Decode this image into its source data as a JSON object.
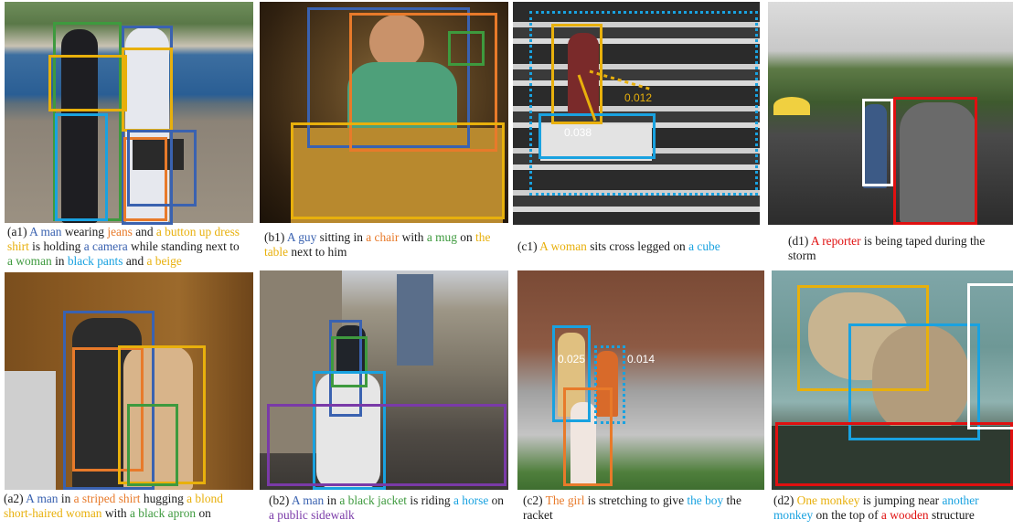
{
  "colors": {
    "blue": "#3a62b0",
    "orange": "#e87a2a",
    "yellow": "#e8b00c",
    "green": "#3e9a3e",
    "cyan": "#19a2e0",
    "red": "#e01010",
    "white": "#ffffff",
    "olive": "#8a9a2a",
    "purple": "#7a3aa8",
    "text": "#1a1a1a"
  },
  "panels": {
    "a1": {
      "label": "(a1)",
      "caption": [
        {
          "text": " A man",
          "color": "blue"
        },
        {
          "text": " wearing ",
          "color": "text"
        },
        {
          "text": "jeans",
          "color": "orange"
        },
        {
          "text": " and ",
          "color": "text"
        },
        {
          "text": "a button up dress shirt",
          "color": "yellow"
        },
        {
          "text": " is holding ",
          "color": "text"
        },
        {
          "text": "a camera",
          "color": "blue"
        },
        {
          "text": " while standing next to ",
          "color": "text"
        },
        {
          "text": "a woman",
          "color": "green"
        },
        {
          "text": " in ",
          "color": "text"
        },
        {
          "text": "black pants",
          "color": "cyan"
        },
        {
          "text": " and ",
          "color": "text"
        },
        {
          "text": "a beige",
          "color": "yellow"
        }
      ]
    },
    "b1": {
      "label": "(b1)",
      "caption": [
        {
          "text": " A guy",
          "color": "blue"
        },
        {
          "text": " sitting in ",
          "color": "text"
        },
        {
          "text": "a chair",
          "color": "orange"
        },
        {
          "text": " with ",
          "color": "text"
        },
        {
          "text": "a mug",
          "color": "green"
        },
        {
          "text": " on ",
          "color": "text"
        },
        {
          "text": "the table",
          "color": "yellow"
        },
        {
          "text": " next to him",
          "color": "text"
        }
      ]
    },
    "c1": {
      "label": "(c1)",
      "labels": [
        "0.012",
        "0.038"
      ],
      "caption": [
        {
          "text": " A woman",
          "color": "yellow"
        },
        {
          "text": " sits cross legged on ",
          "color": "text"
        },
        {
          "text": "a cube",
          "color": "cyan"
        }
      ]
    },
    "d1": {
      "label": "(d1)",
      "caption": [
        {
          "text": " A reporter",
          "color": "red"
        },
        {
          "text": " is being taped during the storm",
          "color": "text"
        }
      ]
    },
    "a2": {
      "label": "(a2)",
      "caption": [
        {
          "text": " A man",
          "color": "blue"
        },
        {
          "text": " in ",
          "color": "text"
        },
        {
          "text": "a striped shirt",
          "color": "orange"
        },
        {
          "text": " hugging ",
          "color": "text"
        },
        {
          "text": "a blond short-haired woman",
          "color": "yellow"
        },
        {
          "text": " with ",
          "color": "text"
        },
        {
          "text": "a black apron",
          "color": "green"
        },
        {
          "text": " on",
          "color": "text"
        }
      ]
    },
    "b2": {
      "label": "(b2)",
      "caption": [
        {
          "text": " A man",
          "color": "blue"
        },
        {
          "text": " in ",
          "color": "text"
        },
        {
          "text": "a black jacket",
          "color": "green"
        },
        {
          "text": " is riding ",
          "color": "text"
        },
        {
          "text": "a horse",
          "color": "cyan"
        },
        {
          "text": " on ",
          "color": "text"
        },
        {
          "text": "a public sidewalk",
          "color": "purple"
        }
      ]
    },
    "c2": {
      "label": "(c2)",
      "labels": [
        "0.025",
        "0.014"
      ],
      "caption": [
        {
          "text": " The girl",
          "color": "orange"
        },
        {
          "text": " is stretching to give ",
          "color": "text"
        },
        {
          "text": "the boy",
          "color": "cyan"
        },
        {
          "text": " the racket",
          "color": "text"
        }
      ]
    },
    "d2": {
      "label": "(d2)",
      "caption": [
        {
          "text": " One monkey",
          "color": "yellow"
        },
        {
          "text": " is jumping near ",
          "color": "text"
        },
        {
          "text": "another monkey",
          "color": "cyan"
        },
        {
          "text": " on the top of ",
          "color": "text"
        },
        {
          "text": "a wooden",
          "color": "red"
        },
        {
          "text": " structure",
          "color": "text"
        }
      ]
    }
  }
}
